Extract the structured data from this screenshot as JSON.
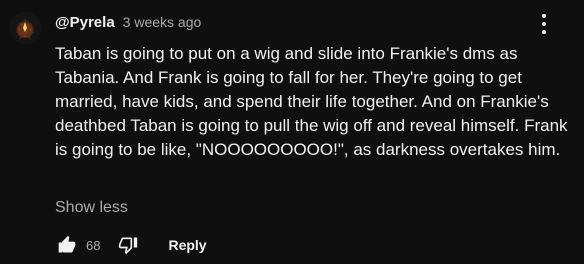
{
  "comment": {
    "author": "@Pyrela",
    "timestamp": "3 weeks ago",
    "text": "Taban is going to put on a wig and slide into Frankie's dms as Tabania. And Frank is going to fall for her. They're going to get married, have kids, and spend their life together. And on Frankie's deathbed Taban is going to pull the wig off and reveal himself. Frank is going to be like, \"NOOOOOOOOO!\", as darkness overtakes him.",
    "show_less_label": "Show less",
    "like_count": "68",
    "reply_label": "Reply",
    "avatar_icon": "avatar-image",
    "menu_icon": "more-vert-icon",
    "like_icon": "thumbs-up-icon",
    "dislike_icon": "thumbs-down-icon"
  },
  "colors": {
    "background": "#0f0f0f",
    "text_primary": "#f1f1f1",
    "text_secondary": "#aaaaaa"
  }
}
